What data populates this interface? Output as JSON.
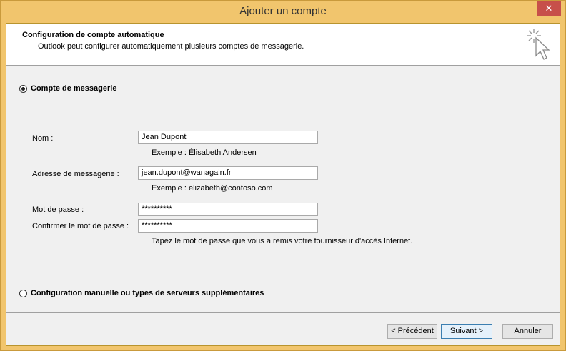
{
  "window": {
    "title": "Ajouter un compte",
    "close_glyph": "✕"
  },
  "header": {
    "title": "Configuration de compte automatique",
    "subtitle": "Outlook peut configurer automatiquement plusieurs comptes de messagerie.",
    "icon": "wizard-cursor-icon"
  },
  "options": {
    "email_account": {
      "label": "Compte de messagerie",
      "selected": true
    },
    "manual": {
      "label": "Configuration manuelle ou types de serveurs supplémentaires",
      "selected": false
    }
  },
  "form": {
    "name": {
      "label": "Nom :",
      "value": "Jean Dupont",
      "hint": "Exemple : Élisabeth Andersen"
    },
    "email": {
      "label": "Adresse de messagerie :",
      "value": "jean.dupont@wanagain.fr",
      "hint": "Exemple : elizabeth@contoso.com"
    },
    "password": {
      "label": "Mot de passe :",
      "value": "**********"
    },
    "confirm": {
      "label": "Confirmer le mot de passe :",
      "value": "**********"
    },
    "password_hint": "Tapez le mot de passe que vous a remis votre fournisseur d'accès Internet."
  },
  "buttons": {
    "back": "< Précédent",
    "next": "Suivant >",
    "cancel": "Annuler"
  }
}
